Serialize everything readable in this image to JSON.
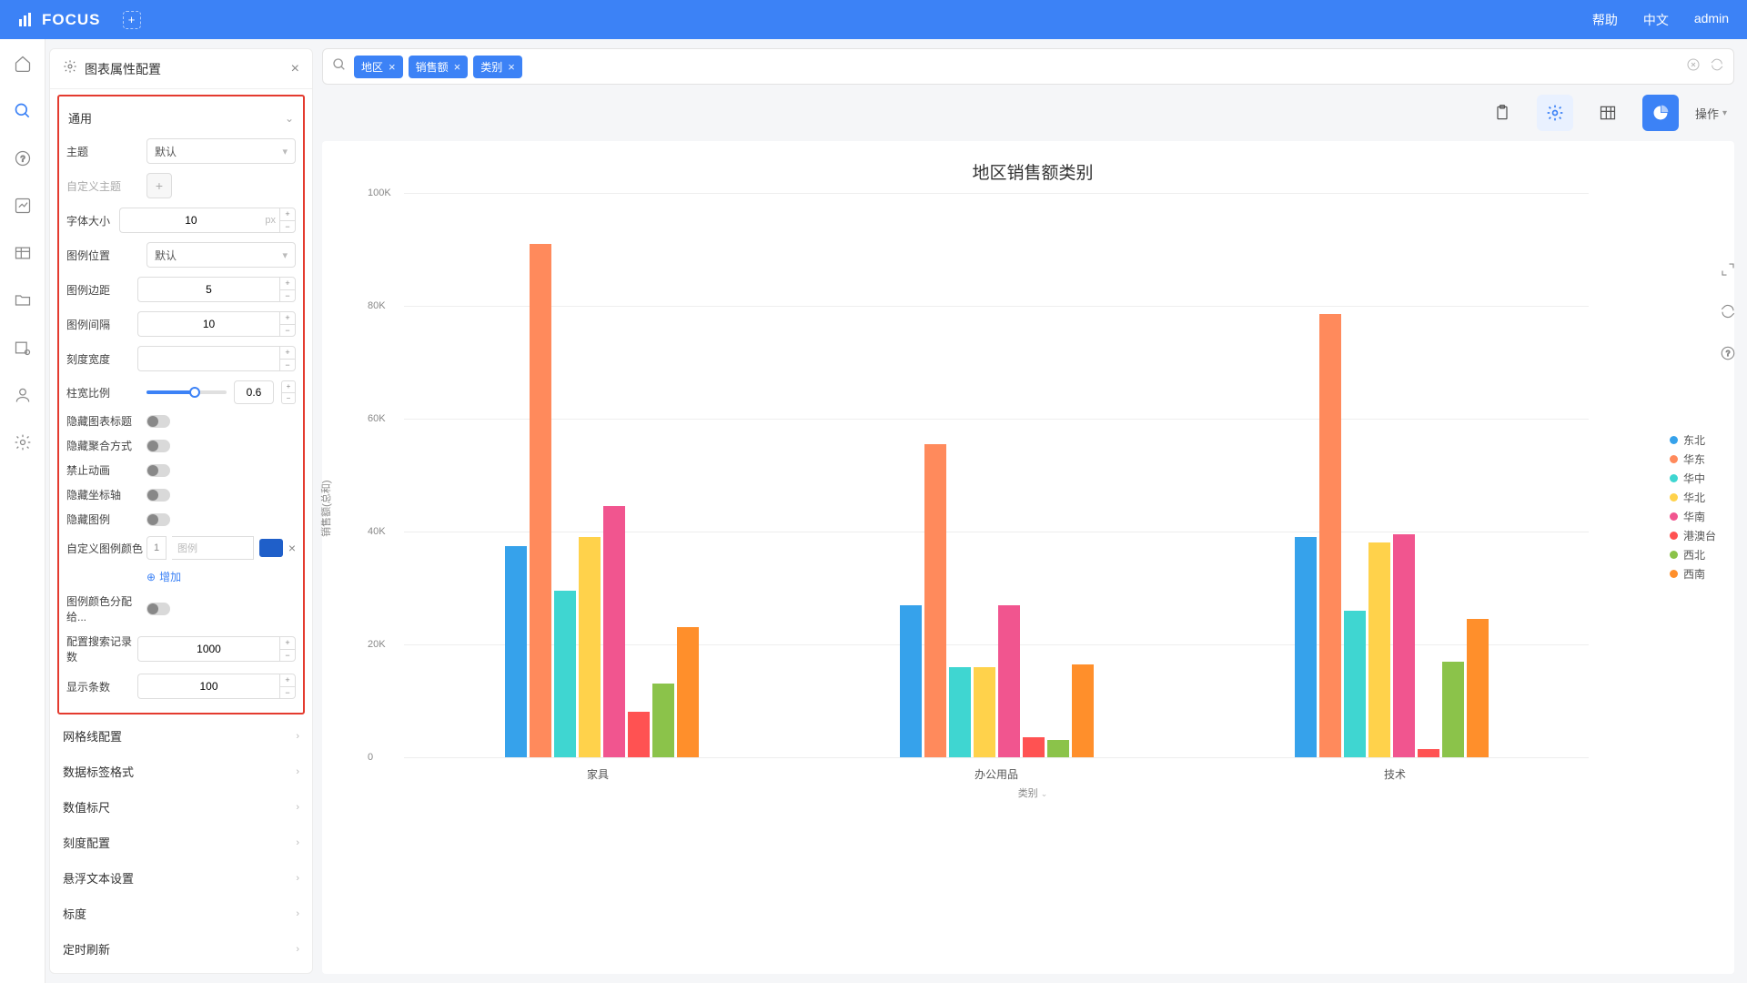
{
  "header": {
    "brand": "FOCUS",
    "help": "帮助",
    "lang": "中文",
    "user": "admin"
  },
  "panel": {
    "title": "图表属性配置",
    "general_section": "通用",
    "labels": {
      "theme": "主题",
      "custom_theme": "自定义主题",
      "font_size": "字体大小",
      "legend_pos": "图例位置",
      "legend_margin": "图例边距",
      "legend_gap": "图例间隔",
      "tick_width": "刻度宽度",
      "bar_ratio": "柱宽比例",
      "hide_title": "隐藏图表标题",
      "hide_agg": "隐藏聚合方式",
      "no_anim": "禁止动画",
      "hide_axis": "隐藏坐标轴",
      "hide_legend": "隐藏图例",
      "custom_legend_color": "自定义图例颜色",
      "legend_placeholder": "图例",
      "add": "增加",
      "color_assign": "图例颜色分配给...",
      "search_limit": "配置搜索记录数",
      "display_count": "显示条数"
    },
    "values": {
      "theme": "默认",
      "font_size": "10",
      "font_unit": "px",
      "legend_pos": "默认",
      "legend_margin": "5",
      "legend_gap": "10",
      "tick_width": "",
      "bar_ratio": "0.6",
      "legend_idx": "1",
      "search_limit": "1000",
      "display_count": "100"
    },
    "collapsed": [
      "网格线配置",
      "数据标签格式",
      "数值标尺",
      "刻度配置",
      "悬浮文本设置",
      "标度",
      "定时刷新"
    ]
  },
  "search": {
    "tags": [
      "地区",
      "销售额",
      "类别"
    ]
  },
  "toolbar": {
    "operate": "操作"
  },
  "chart_title": "地区销售额类别",
  "xaxis_name": "类别",
  "yaxis_name": "销售额(总和)",
  "chart_data": {
    "type": "bar",
    "categories": [
      "家具",
      "办公用品",
      "技术"
    ],
    "series": [
      {
        "name": "东北",
        "color": "#36a2eb",
        "values": [
          37500,
          27000,
          39000
        ]
      },
      {
        "name": "华东",
        "color": "#ff8a5c",
        "values": [
          91000,
          55500,
          78500
        ]
      },
      {
        "name": "华中",
        "color": "#3fd6d1",
        "values": [
          29500,
          16000,
          26000
        ]
      },
      {
        "name": "华北",
        "color": "#ffd24b",
        "values": [
          39000,
          16000,
          38000
        ]
      },
      {
        "name": "华南",
        "color": "#f1558f",
        "values": [
          44500,
          27000,
          39500
        ]
      },
      {
        "name": "港澳台",
        "color": "#ff5252",
        "values": [
          8000,
          3500,
          1500
        ]
      },
      {
        "name": "西北",
        "color": "#8bc34a",
        "values": [
          13000,
          3000,
          17000
        ]
      },
      {
        "name": "西南",
        "color": "#ff8f2b",
        "values": [
          23000,
          16500,
          24500
        ]
      }
    ],
    "ylim": [
      0,
      100000
    ],
    "yticks": [
      0,
      20000,
      40000,
      60000,
      80000,
      100000
    ],
    "ylabels": [
      "0",
      "20K",
      "40K",
      "60K",
      "80K",
      "100K"
    ]
  }
}
